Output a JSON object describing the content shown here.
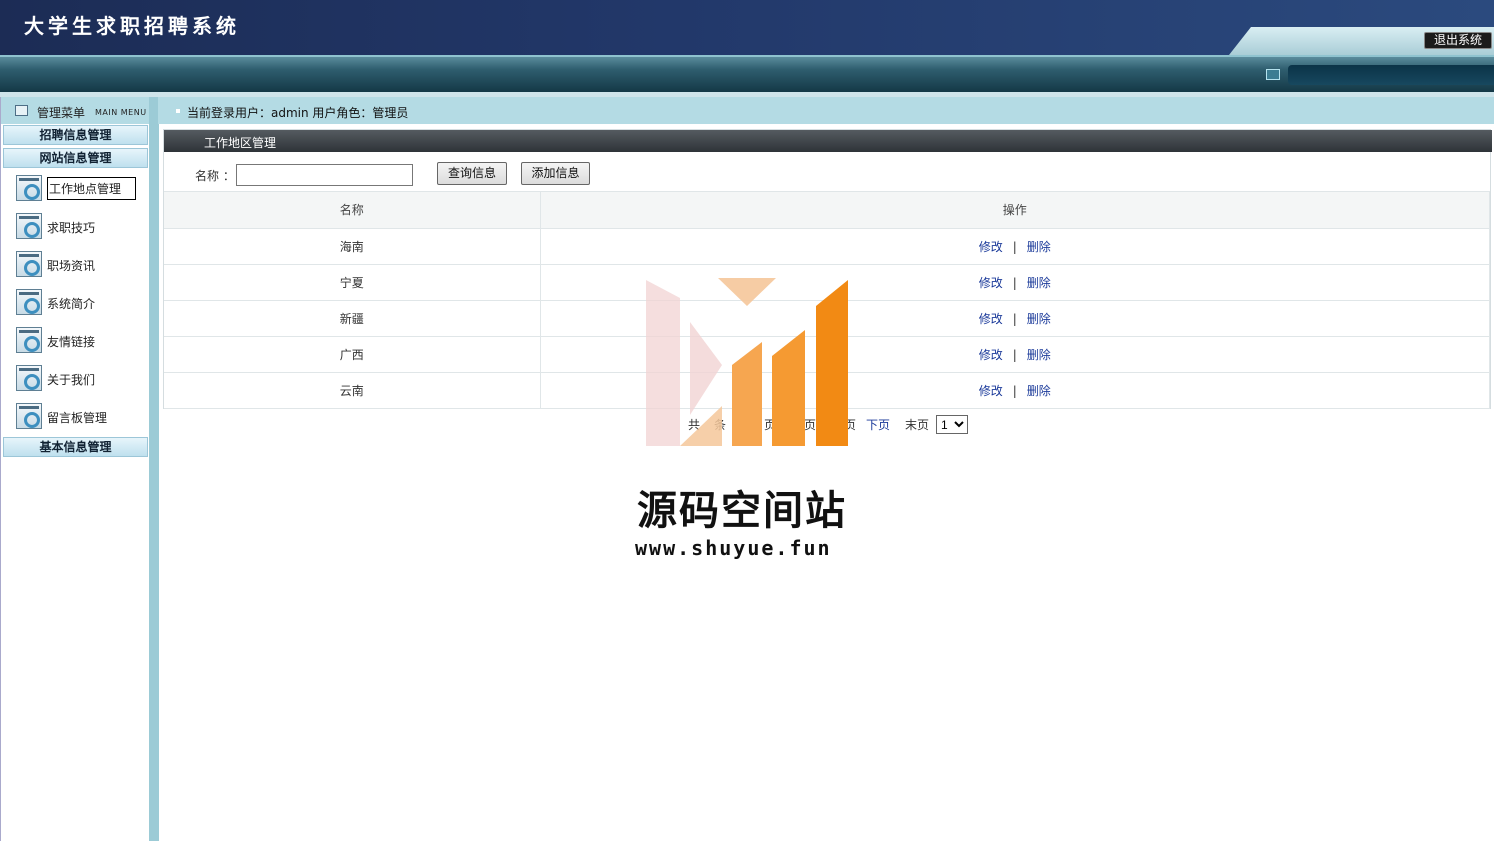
{
  "app": {
    "title": "大学生求职招聘系统",
    "logout_label": "退出系统"
  },
  "menu": {
    "title": "管理菜单",
    "subtitle": "MAIN MENU",
    "categories": [
      {
        "label": "招聘信息管理"
      },
      {
        "label": "网站信息管理"
      },
      {
        "label": "基本信息管理"
      }
    ],
    "items": [
      {
        "label": "工作地点管理"
      },
      {
        "label": "求职技巧"
      },
      {
        "label": "职场资讯"
      },
      {
        "label": "系统简介"
      },
      {
        "label": "友情链接"
      },
      {
        "label": "关于我们"
      },
      {
        "label": "留言板管理"
      }
    ]
  },
  "header": {
    "user_info": "当前登录用户：admin  用户角色：管理员"
  },
  "panel": {
    "title": "工作地区管理",
    "search_label": "名称 ：",
    "search_value": "",
    "query_button": "查询信息",
    "add_button": "添加信息"
  },
  "table": {
    "columns": [
      "名称",
      "操作"
    ],
    "rows": [
      {
        "name": "海南",
        "edit": "修改",
        "sep": "|",
        "delete": "删除"
      },
      {
        "name": "宁夏",
        "edit": "修改",
        "sep": "|",
        "delete": "删除"
      },
      {
        "name": "新疆",
        "edit": "修改",
        "sep": "|",
        "delete": "删除"
      },
      {
        "name": "广西",
        "edit": "修改",
        "sep": "|",
        "delete": "删除"
      },
      {
        "name": "云南",
        "edit": "修改",
        "sep": "|",
        "delete": "删除"
      }
    ]
  },
  "pager": {
    "total_prefix": "共",
    "total_suffix": "条",
    "page_a": "页",
    "page_b": "页",
    "page_c": "页",
    "next": "下页",
    "last": "末页",
    "selected_page": "1"
  },
  "watermark": {
    "name": "源码空间站",
    "url": "www.shuyue.fun"
  },
  "colors": {
    "top_dark": "#1c2c55",
    "nav_teal": "#2f5e6f",
    "menu_bg": "#b4dbe4",
    "link": "#1b3a9a",
    "wm_orange": "#f28a14",
    "wm_pink": "#f1d3d3"
  }
}
